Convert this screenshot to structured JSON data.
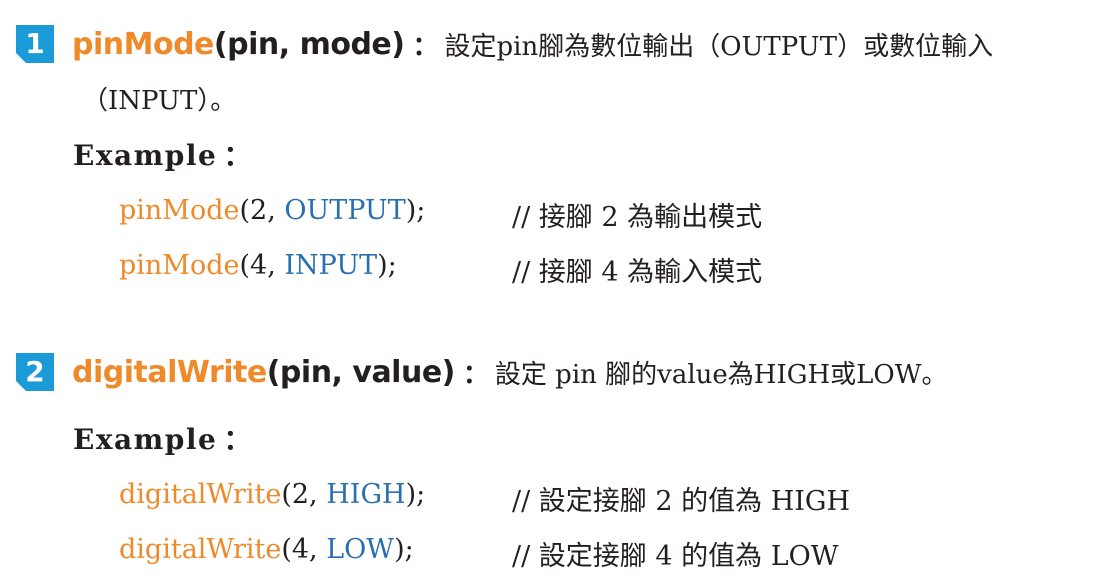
{
  "sections": [
    {
      "number": "1",
      "function_name": "pinMode",
      "function_args": "(pin, mode)",
      "colon": "：",
      "description": "設定pin腳為數位輸出（OUTPUT）或數位輸入",
      "description_continued": "（INPUT）。",
      "example_label": "Example",
      "example_colon": "：",
      "examples": [
        {
          "fn": "pinMode",
          "open": "(2, ",
          "const": "OUTPUT",
          "close": ");",
          "comment": "// 接腳 2 為輸出模式"
        },
        {
          "fn": "pinMode",
          "open": "(4, ",
          "const": "INPUT",
          "close": ");",
          "comment": "// 接腳 4 為輸入模式"
        }
      ]
    },
    {
      "number": "2",
      "function_name": "digitalWrite",
      "function_args": "(pin, value)",
      "colon": "：",
      "description": "設定 pin 腳的value為HIGH或LOW。",
      "example_label": "Example",
      "example_colon": "：",
      "examples": [
        {
          "fn": "digitalWrite",
          "open": "(2, ",
          "const": "HIGH",
          "close": ");",
          "comment": "// 設定接腳 2 的值為 HIGH"
        },
        {
          "fn": "digitalWrite",
          "open": "(4, ",
          "const": "LOW",
          "close": ");",
          "comment": "// 設定接腳 4 的值為 LOW"
        }
      ]
    }
  ],
  "colors": {
    "badge": "#1a9ad6",
    "function_name": "#ef8a2b",
    "constant": "#2a6fb0",
    "text": "#231f20"
  }
}
